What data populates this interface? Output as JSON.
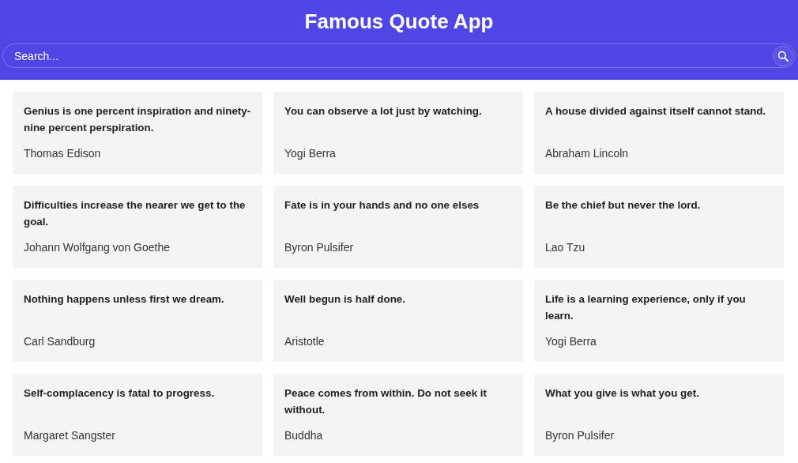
{
  "header": {
    "title": "Famous Quote App"
  },
  "search": {
    "placeholder": "Search..."
  },
  "quotes": [
    {
      "text": "Genius is one percent inspiration and ninety-nine percent perspiration.",
      "author": "Thomas Edison"
    },
    {
      "text": "You can observe a lot just by watching.",
      "author": "Yogi Berra"
    },
    {
      "text": "A house divided against itself cannot stand.",
      "author": "Abraham Lincoln"
    },
    {
      "text": "Difficulties increase the nearer we get to the goal.",
      "author": "Johann Wolfgang von Goethe"
    },
    {
      "text": "Fate is in your hands and no one elses",
      "author": "Byron Pulsifer"
    },
    {
      "text": "Be the chief but never the lord.",
      "author": "Lao Tzu"
    },
    {
      "text": "Nothing happens unless first we dream.",
      "author": "Carl Sandburg"
    },
    {
      "text": "Well begun is half done.",
      "author": "Aristotle"
    },
    {
      "text": "Life is a learning experience, only if you learn.",
      "author": "Yogi Berra"
    },
    {
      "text": "Self-complacency is fatal to progress.",
      "author": "Margaret Sangster"
    },
    {
      "text": "Peace comes from within. Do not seek it without.",
      "author": "Buddha"
    },
    {
      "text": "What you give is what you get.",
      "author": "Byron Pulsifer"
    }
  ]
}
